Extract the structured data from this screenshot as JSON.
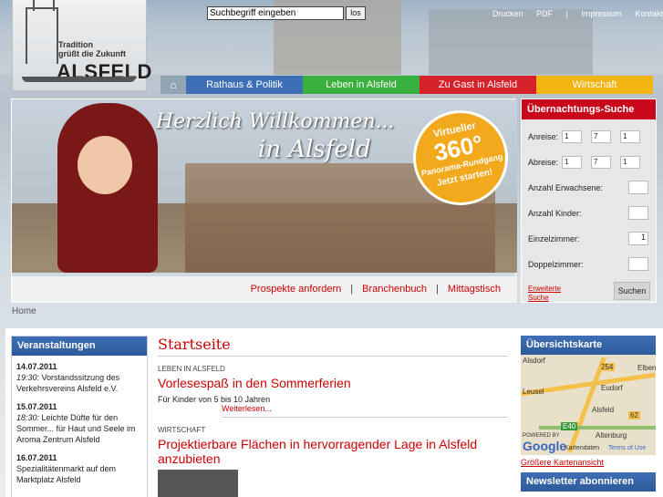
{
  "logo": {
    "slogan_1": "Tradition",
    "slogan_2": "grüßt die Zukunft",
    "name": "ALSFELD"
  },
  "search": {
    "placeholder": "Suchbegriff eingeben",
    "button": "los"
  },
  "topnav": [
    "Drucken",
    "PDF",
    "|",
    "Impressum",
    "Kontakt"
  ],
  "mainnav": {
    "home_icon": "house-icon",
    "tabs": [
      {
        "label": "Rathaus & Politik",
        "color": "#3d6fb6"
      },
      {
        "label": "Leben in Alsfeld",
        "color": "#3ab03e"
      },
      {
        "label": "Zu Gast in Alsfeld",
        "color": "#d6222b"
      },
      {
        "label": "Wirtschaft",
        "color": "#f2b411"
      }
    ]
  },
  "banner": {
    "title_1": "Herzlich Willkommen...",
    "title_2": "in Alsfeld",
    "seal": {
      "line1": "Virtueller",
      "number": "360°",
      "line2": "Panorama-Rundgang",
      "line3": "Jetzt starten!"
    },
    "links": [
      "Prospekte anfordern",
      "Branchenbuch",
      "Mittagstisch"
    ]
  },
  "hotel": {
    "title": "Übernachtungs-Suche",
    "anreise_label": "Anreise:",
    "abreise_label": "Abreise:",
    "anreise": [
      "1",
      "7",
      "1"
    ],
    "abreise": [
      "1",
      "7",
      "1"
    ],
    "erwachsene_label": "Anzahl Erwachsene:",
    "kinder_label": "Anzahl Kinder:",
    "einzel_label": "Einzelzimmer:",
    "einzel_value": "1",
    "doppel_label": "Doppelzimmer:",
    "advanced_1": "Erweiterte",
    "advanced_2": "Suche",
    "submit": "Suchen"
  },
  "breadcrumb": "Home",
  "events": {
    "title": "Veranstaltungen",
    "items": [
      {
        "date": "14.07.2011",
        "time": "19:30:",
        "text": "Vorstandssitzung des Verkehrsvereins Alsfeld e.V."
      },
      {
        "date": "15.07.2011",
        "time": "18:30:",
        "text": "Leichte Düfte für den Sommer... für Haut und Seele im Aroma Zentrum Alsfeld"
      },
      {
        "date": "16.07.2011",
        "time": "",
        "text": "Spezialitätenmarkt auf dem Marktplatz Alsfeld"
      }
    ]
  },
  "main": {
    "heading": "Startseite",
    "articles": [
      {
        "category": "LEBEN IN ALSFELD",
        "title": "Vorlesespaß in den Sommerferien",
        "subtitle": "Für Kinder von 5 bis 10 Jahren",
        "more": "Weiterlesen..."
      },
      {
        "category": "WIRTSCHAFT",
        "title": "Projektierbare Flächen in hervorragender Lage in Alsfeld anzubieten"
      }
    ]
  },
  "map": {
    "title": "Übersichtskarte",
    "labels": [
      "Alsdorf",
      "254",
      "Elbenr",
      "Eudorf",
      "Alsfeld",
      "62",
      "Altenburg",
      "Leusel",
      "E40"
    ],
    "powered": "POWERED BY",
    "google": "Google",
    "data": "Kartendaten",
    "terms": "Terms of Use",
    "link": "Größere Kartenansicht"
  },
  "newsletter": {
    "title": "Newsletter abonnieren"
  }
}
